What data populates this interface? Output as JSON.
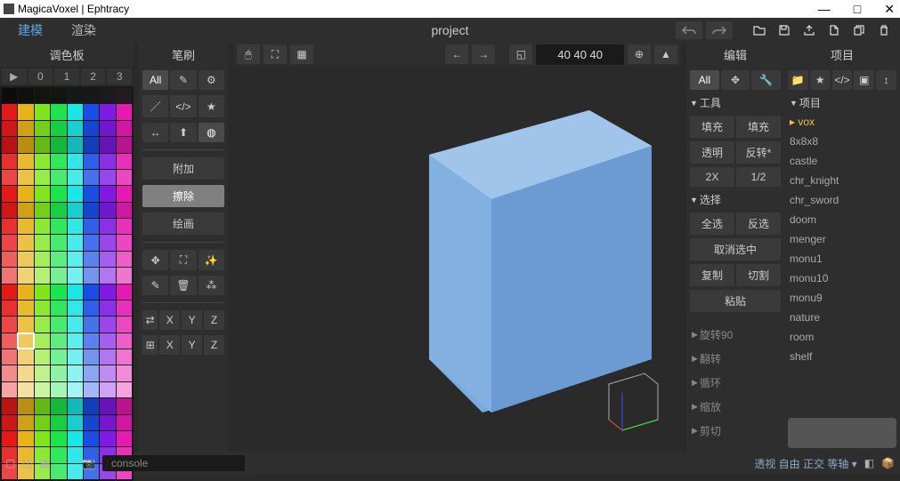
{
  "window": {
    "title": "MagicaVoxel | Ephtracy"
  },
  "topbar": {
    "tabs": [
      {
        "label": "建模",
        "active": true
      },
      {
        "label": "渲染",
        "active": false
      }
    ],
    "project_title": "project",
    "icons": [
      "undo",
      "redo",
      "|",
      "open",
      "save",
      "export",
      "new",
      "copy",
      "delete"
    ]
  },
  "palette": {
    "title": "调色板",
    "index_tabs": [
      "▶",
      "0",
      "1",
      "2",
      "3"
    ]
  },
  "brush": {
    "title": "笔刷",
    "all_label": "All",
    "mode_labels": [
      "附加",
      "擦除",
      "绘画"
    ],
    "mode_active": 1,
    "mirror_label": "⇄",
    "axes": [
      "X",
      "Y",
      "Z"
    ]
  },
  "viewport": {
    "dims": "40 40 40",
    "toolbar_icons": [
      "pointer",
      "expand",
      "grid",
      "|",
      "arrow-left",
      "arrow-right",
      "|",
      "crop",
      "dims",
      "fit",
      "up"
    ]
  },
  "edit": {
    "title": "编辑",
    "all_label": "All",
    "sections": {
      "tool": {
        "label": "工具",
        "buttons": [
          [
            "填充",
            "填充"
          ],
          [
            "透明",
            "反转*"
          ],
          [
            "2X",
            "1/2"
          ]
        ]
      },
      "select": {
        "label": "选择",
        "buttons_2": [
          [
            "全选",
            "反选"
          ]
        ],
        "cancel": "取消选中",
        "copy_cut": [
          "复制",
          "切割"
        ],
        "paste": "粘贴"
      },
      "collapsed": [
        "旋转90",
        "翻转",
        "循环",
        "缩放",
        "剪切"
      ]
    }
  },
  "project": {
    "title": "项目",
    "header_label": "项目",
    "items": [
      "vox",
      "8x8x8",
      "castle",
      "chr_knight",
      "chr_sword",
      "doom",
      "menger",
      "monu1",
      "monu10",
      "monu9",
      "nature",
      "room",
      "shelf"
    ],
    "selected": 0
  },
  "bottombar": {
    "console_label": "console",
    "status": "透视  自由  正交  等轴  ▾"
  }
}
